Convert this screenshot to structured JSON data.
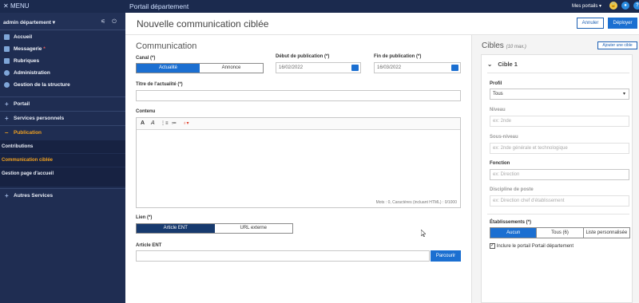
{
  "topbar": {
    "menu_label": "MENU",
    "portal_title": "Portail département",
    "mes_portails": "Mes portails",
    "icons": [
      "lock-icon",
      "bell-icon",
      "help-icon"
    ]
  },
  "sidebar": {
    "user_name": "admin département",
    "items": [
      {
        "label": "Accueil",
        "icon": "grid-icon"
      },
      {
        "label": "Messagerie",
        "icon": "mail-icon",
        "badge": "*"
      },
      {
        "label": "Rubriques",
        "icon": "book-icon"
      },
      {
        "label": "Administration",
        "icon": "gear-icon"
      },
      {
        "label": "Gestion de la structure",
        "icon": "structure-icon"
      }
    ],
    "sections": [
      {
        "label": "Portail",
        "prefix": "+"
      },
      {
        "label": "Services personnels",
        "prefix": "+"
      },
      {
        "label": "Publication",
        "prefix": "–"
      }
    ],
    "sub_items": [
      "Contributions",
      "Communication ciblée",
      "Gestion page d'accueil"
    ],
    "autres": {
      "label": "Autres Services",
      "prefix": "+"
    }
  },
  "main": {
    "page_title": "Nouvelle communication ciblée",
    "btn_annuler": "Annuler",
    "btn_deployer": "Déployer",
    "section_title": "Communication",
    "canal_label": "Canal (*)",
    "canal_options": [
      "Actualité",
      "Annonce"
    ],
    "debut_label": "Début de publication (*)",
    "debut_value": "16/02/2022",
    "fin_label": "Fin de publication (*)",
    "fin_value": "16/03/2022",
    "titre_label": "Titre de l'actualité (*)",
    "titre_value": "",
    "contenu_label": "Contenu",
    "editor_tools": [
      "A",
      "A",
      "⋮≡",
      "≔",
      "♁▾"
    ],
    "char_count": "Mots : 0, Caractères (incluant HTML) : 0/1000",
    "lien_label": "Lien (*)",
    "lien_options": [
      "Article ENT",
      "URL externe"
    ],
    "article_label": "Article ENT",
    "article_value": "",
    "parcourir": "Parcourir"
  },
  "cibles": {
    "title": "Cibles",
    "max": "(10 max.)",
    "add_btn": "Ajouter une cible",
    "cible_title": "Cible 1",
    "profil_label": "Profil",
    "profil_value": "Tous",
    "niveau_label": "Niveau",
    "niveau_placeholder": "ex: 2nde",
    "sous_niveau_label": "Sous-niveau",
    "sous_niveau_placeholder": "ex: 2nde générale et technologique",
    "fonction_label": "Fonction",
    "fonction_placeholder": "ex: Direction",
    "discipline_label": "Discipline de poste",
    "discipline_placeholder": "ex: Direction chef d'établissement",
    "etab_label": "Établissements (*)",
    "etab_options": [
      "Aucun",
      "Tous (6)",
      "Liste personnalisée"
    ],
    "include_label": "Inclure le portail Portail département",
    "include_checked": true
  }
}
